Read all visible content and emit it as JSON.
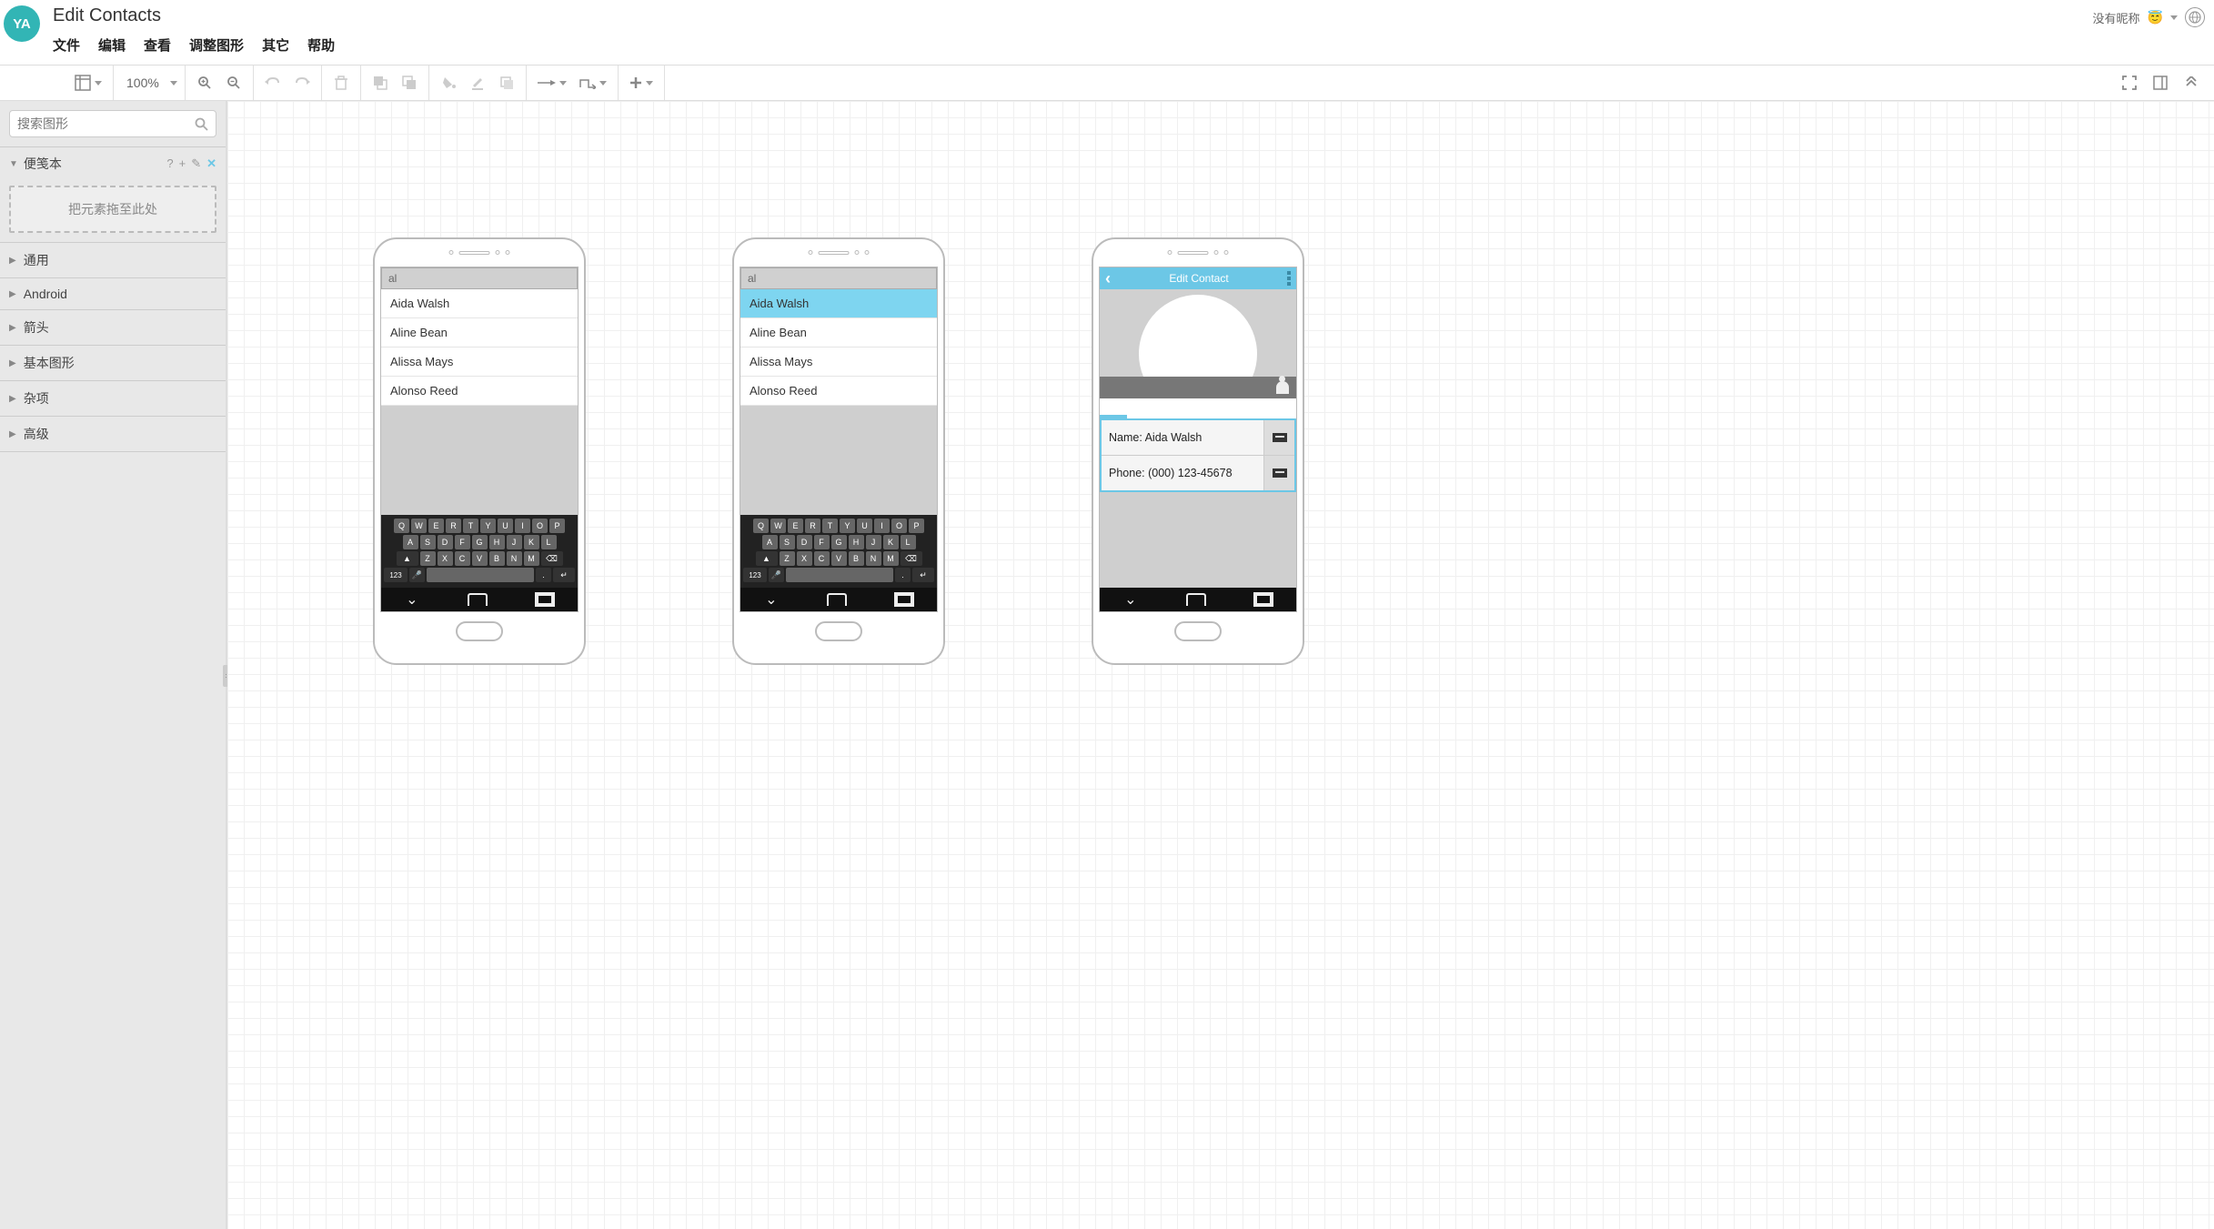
{
  "logo_text": "YA",
  "doc_title": "Edit Contacts",
  "menu": [
    "文件",
    "编辑",
    "查看",
    "调整图形",
    "其它",
    "帮助"
  ],
  "user_label": "没有昵称",
  "toolbar": {
    "zoom": "100%"
  },
  "sidebar": {
    "search_placeholder": "搜索图形",
    "scratchpad_title": "便笺本",
    "dropzone_text": "把元素拖至此处",
    "categories": [
      "通用",
      "Android",
      "箭头",
      "基本图形",
      "杂项",
      "高级"
    ]
  },
  "phone1": {
    "search": "al",
    "contacts": [
      "Aida Walsh",
      "Aline Bean",
      "Alissa Mays",
      "Alonso Reed"
    ],
    "selected_index": -1
  },
  "phone2": {
    "search": "al",
    "contacts": [
      "Aida Walsh",
      "Aline Bean",
      "Alissa Mays",
      "Alonso Reed"
    ],
    "selected_index": 0
  },
  "phone3": {
    "header": "Edit Contact",
    "name_label": "Name: Aida Walsh",
    "phone_label": "Phone: (000) 123-45678"
  },
  "keyboard": {
    "row1": [
      "Q",
      "W",
      "E",
      "R",
      "T",
      "Y",
      "U",
      "I",
      "O",
      "P"
    ],
    "row2": [
      "A",
      "S",
      "D",
      "F",
      "G",
      "H",
      "J",
      "K",
      "L"
    ],
    "row3": [
      "Z",
      "X",
      "C",
      "V",
      "B",
      "N",
      "M"
    ],
    "num_key": "123",
    "period": "."
  }
}
